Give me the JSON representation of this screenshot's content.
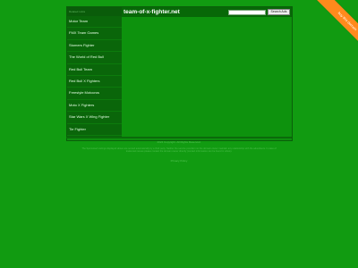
{
  "header": {
    "site_title": "team-of-x-fighter.net",
    "search_placeholder": "",
    "search_button_label": "Search Ads"
  },
  "sidebar": {
    "heading": "Related Links",
    "items": [
      {
        "label": "Motor Team"
      },
      {
        "label": "FMX Team Games"
      },
      {
        "label": "Stomers Fighter"
      },
      {
        "label": "The World of Red Bull"
      },
      {
        "label": "Red Bull Team"
      },
      {
        "label": "Red Bull X Fighters"
      },
      {
        "label": "Freestyle Motocros"
      },
      {
        "label": "Moto X Fighters"
      },
      {
        "label": "Star Wars X Wing Fighter"
      },
      {
        "label": "Tie Fighter"
      }
    ]
  },
  "footer": {
    "copyright": "2024 Copyright. All Rights Reserved.",
    "disclaimer": "The Sponsored Listings displayed above are served automatically by a third party. Neither the service provider nor the domain owner maintain any relationship with the advertisers. In case of trademark issues please contact the domain owner directly (contact information can be found in whois).",
    "privacy_label": "Privacy Policy"
  },
  "ribbon": {
    "label": "buy this domain"
  },
  "colors": {
    "background": "#119b11",
    "sidebar": "#0a660a",
    "ribbon": "#ff8a1c"
  }
}
